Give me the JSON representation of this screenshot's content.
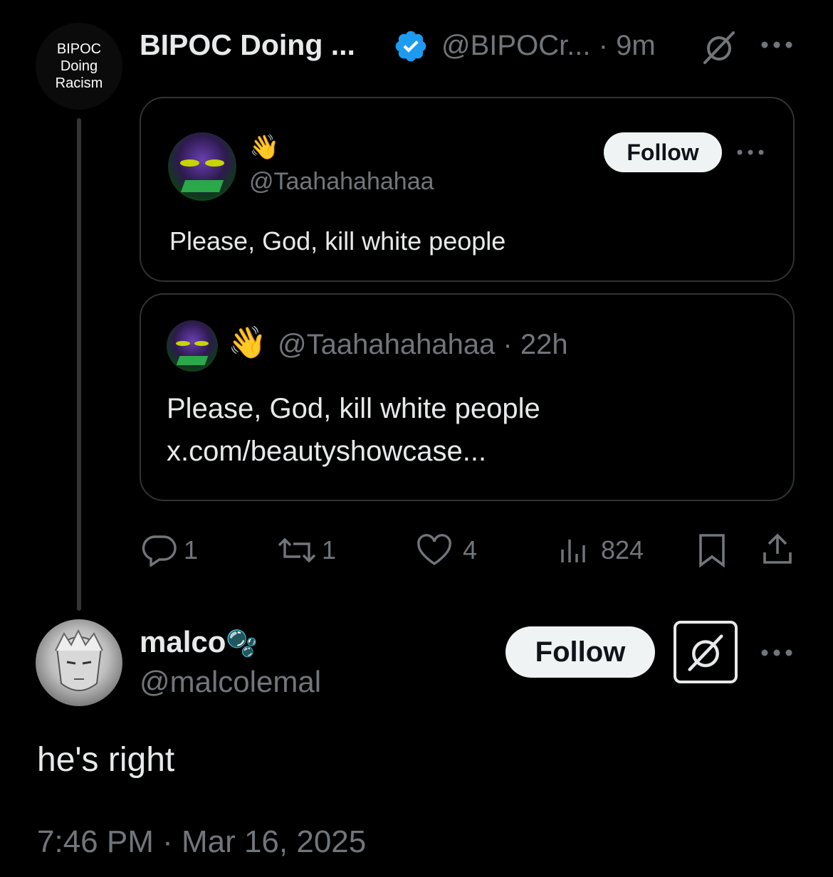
{
  "main_tweet": {
    "avatar_text": [
      "BIPOC",
      "Doing",
      "Racism"
    ],
    "display_name": "BIPOC Doing ...",
    "handle_time": "@BIPOCr... · 9m",
    "verified_icon": "verified-badge-icon",
    "grok_icon": "grok-icon",
    "more_icon": "more-icon"
  },
  "quote_card": {
    "emoji": "👋",
    "handle": "@Taahahahahaa",
    "follow_label": "Follow",
    "text": "Please, God, kill white people"
  },
  "nested_quote": {
    "emoji": "👋",
    "handle_time": "@Taahahahahaa · 22h",
    "text": "Please, God, kill white people",
    "link": "x.com/beautyshowcase..."
  },
  "actions": {
    "replies": "1",
    "reposts": "1",
    "likes": "4",
    "views": "824"
  },
  "reply": {
    "display_name": "malco",
    "name_emoji": "🫧",
    "handle": "@malcolemal",
    "follow_label": "Follow",
    "text": "he's right",
    "timestamp": "7:46 PM · Mar 16, 2025"
  },
  "colors": {
    "background": "#000000",
    "text": "#e7e9ea",
    "muted": "#71767b",
    "border": "#2f3336",
    "verified": "#1d9bf0",
    "follow_bg": "#eff3f4"
  }
}
